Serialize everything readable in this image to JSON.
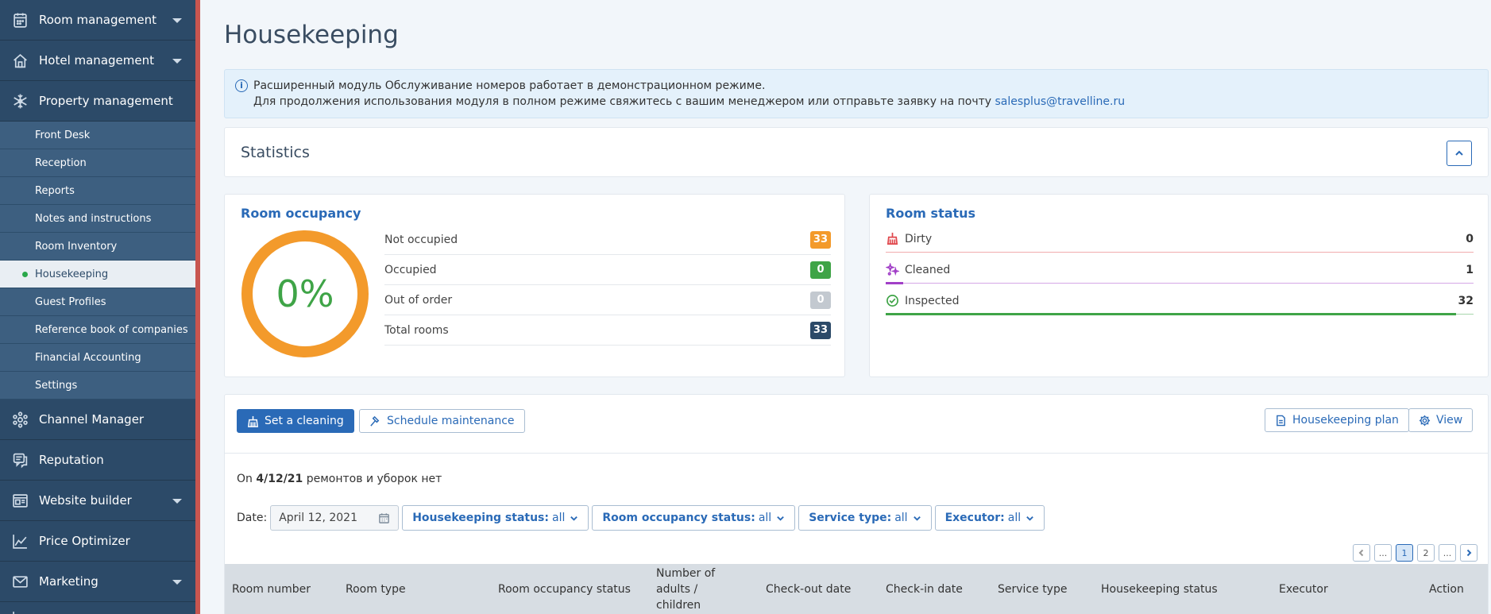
{
  "sidebar": {
    "top_items": [
      {
        "label": "Room management",
        "icon": "calendar-icon",
        "has_caret": true
      },
      {
        "label": "Hotel management",
        "icon": "home-icon",
        "has_caret": true
      },
      {
        "label": "Property management",
        "icon": "snowflake-icon",
        "has_caret": false
      }
    ],
    "sub_items": [
      {
        "label": "Front Desk"
      },
      {
        "label": "Reception"
      },
      {
        "label": "Reports"
      },
      {
        "label": "Notes and instructions"
      },
      {
        "label": "Room Inventory"
      },
      {
        "label": "Housekeeping",
        "active": true
      },
      {
        "label": "Guest Profiles"
      },
      {
        "label": "Reference book of companies"
      },
      {
        "label": "Financial Accounting"
      },
      {
        "label": "Settings"
      }
    ],
    "bottom_items": [
      {
        "label": "Channel Manager",
        "icon": "hub-icon",
        "has_caret": false
      },
      {
        "label": "Reputation",
        "icon": "chat-icon",
        "has_caret": false
      },
      {
        "label": "Website builder",
        "icon": "website-icon",
        "has_caret": true
      },
      {
        "label": "Price Optimizer",
        "icon": "chart-line-icon",
        "has_caret": false
      },
      {
        "label": "Marketing",
        "icon": "mail-icon",
        "has_caret": true
      }
    ]
  },
  "page": {
    "title": "Housekeeping"
  },
  "info": {
    "line1": "Расширенный модуль Обслуживание номеров работает в демонстрационном режиме.",
    "line2": "Для продолжения использования модуля в полном режиме свяжитесь с вашим менеджером или отправьте заявку на почту",
    "email": "salesplus@travelline.ru"
  },
  "statistics": {
    "title": "Statistics"
  },
  "occupancy": {
    "title": "Room occupancy",
    "percent_label": "0%",
    "percent": 0,
    "rows": [
      {
        "label": "Not occupied",
        "value": "33",
        "color": "#f39a2b"
      },
      {
        "label": "Occupied",
        "value": "0",
        "color": "#3fa447"
      },
      {
        "label": "Out of order",
        "value": "0",
        "color": "#c3c9d0"
      },
      {
        "label": "Total rooms",
        "value": "33",
        "color": "#2c4a68"
      }
    ],
    "ring_color": "#f39a2b"
  },
  "room_status": {
    "title": "Room status",
    "rows": [
      {
        "label": "Dirty",
        "value": "0",
        "icon": "broom-icon",
        "color": "#e0474c",
        "fraction": 0
      },
      {
        "label": "Cleaned",
        "value": "1",
        "icon": "sparkle-icon",
        "color": "#a13fc7",
        "fraction": 0.03
      },
      {
        "label": "Inspected",
        "value": "32",
        "icon": "check-circle-icon",
        "color": "#3fa447",
        "fraction": 0.97
      }
    ]
  },
  "toolbar": {
    "set_cleaning": "Set a cleaning",
    "schedule_maintenance": "Schedule maintenance",
    "housekeeping_plan": "Housekeeping plan",
    "view": "View"
  },
  "summary": {
    "prefix": "On",
    "date": "4/12/21",
    "suffix": "ремонтов и уборок нет"
  },
  "filters": {
    "date_label": "Date:",
    "date_value": "April 12, 2021",
    "dropdowns": [
      {
        "key": "Housekeeping status:",
        "value": "all"
      },
      {
        "key": "Room occupancy status:",
        "value": "all"
      },
      {
        "key": "Service type:",
        "value": "all"
      },
      {
        "key": "Executor:",
        "value": "all"
      }
    ]
  },
  "pager": {
    "ellipsis": "...",
    "pages": [
      "1",
      "2"
    ],
    "current": "1"
  },
  "table": {
    "columns": [
      "Room number",
      "Room type",
      "Room occupancy status",
      "Number of adults / children",
      "Check-out date",
      "Check-in date",
      "Service type",
      "Housekeeping status",
      "Executor",
      "Action"
    ]
  }
}
